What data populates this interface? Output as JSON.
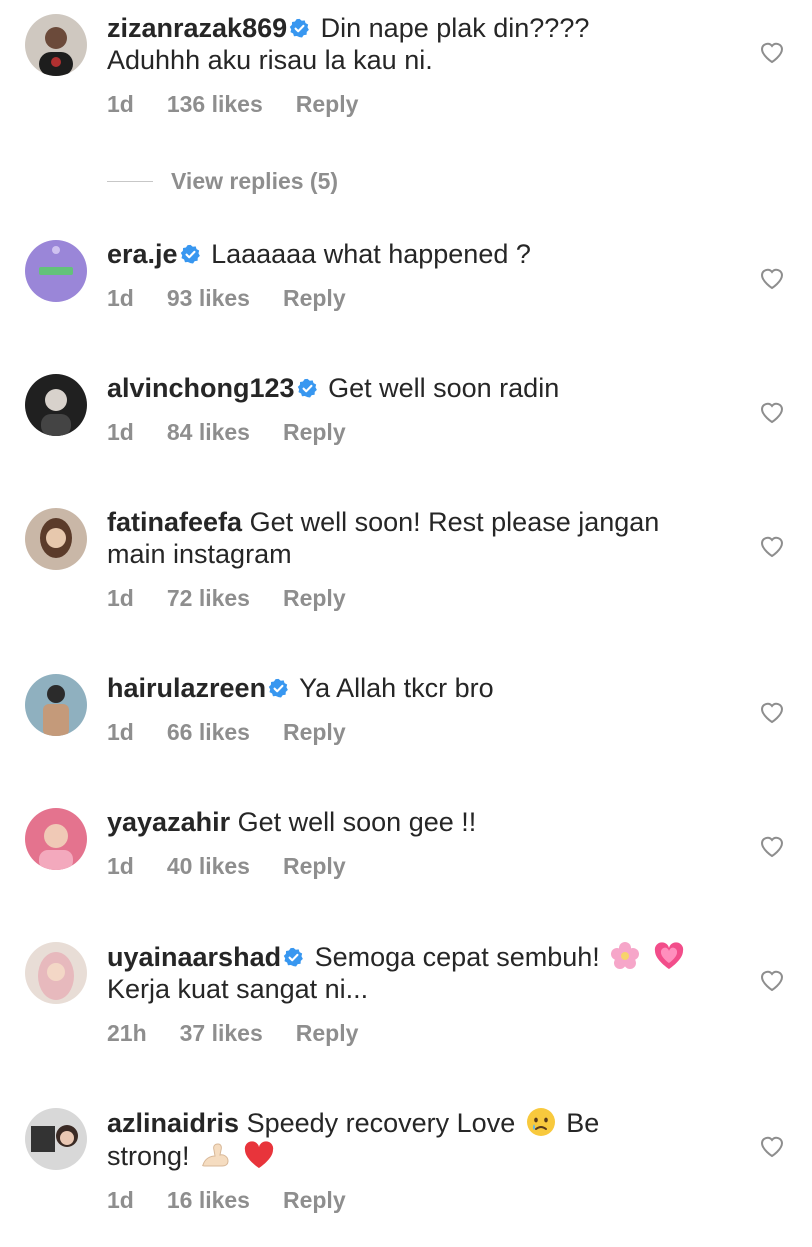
{
  "comments": [
    {
      "username": "zizanrazak869",
      "verified": true,
      "text": "Din nape plak din????\nAduhhh aku risau la kau ni.",
      "time": "1d",
      "likes": "136 likes",
      "reply": "Reply"
    },
    {
      "username": "era.je",
      "verified": true,
      "text": "Laaaaaa what happened ?",
      "time": "1d",
      "likes": "93 likes",
      "reply": "Reply"
    },
    {
      "username": "alvinchong123",
      "verified": true,
      "text": "Get well soon radin",
      "time": "1d",
      "likes": "84 likes",
      "reply": "Reply"
    },
    {
      "username": "fatinafeefa",
      "verified": false,
      "text": "Get well soon! Rest please jangan\nmain instagram",
      "time": "1d",
      "likes": "72 likes",
      "reply": "Reply"
    },
    {
      "username": "hairulazreen",
      "verified": true,
      "text": "Ya Allah tkcr bro",
      "time": "1d",
      "likes": "66 likes",
      "reply": "Reply"
    },
    {
      "username": "yayazahir",
      "verified": false,
      "text": "Get well soon gee !!",
      "time": "1d",
      "likes": "40 likes",
      "reply": "Reply"
    },
    {
      "username": "uyainaarshad",
      "verified": true,
      "text_a": "Semoga cepat sembuh!",
      "text_b": "Kerja kuat sangat ni...",
      "time": "21h",
      "likes": "37 likes",
      "reply": "Reply"
    },
    {
      "username": "azlinaidris",
      "verified": false,
      "text_a": "Speedy recovery Love",
      "text_b": "Be",
      "text_c": "strong!",
      "time": "1d",
      "likes": "16 likes",
      "reply": "Reply"
    }
  ],
  "view_replies": "View replies (5)",
  "icons": {
    "verified_badge": "verified-badge-icon",
    "like": "heart-outline-icon"
  },
  "colors": {
    "verified": "#3897f0",
    "meta": "#8e8e8e",
    "text": "#262626"
  }
}
